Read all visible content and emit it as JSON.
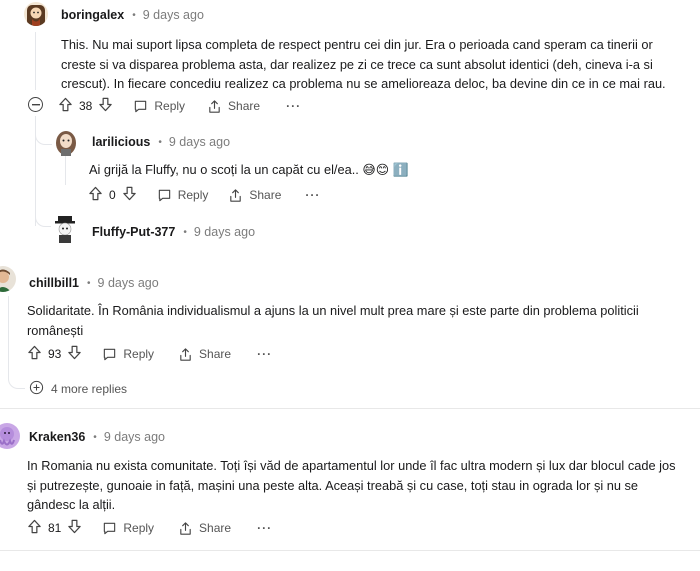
{
  "comments": [
    {
      "user": "boringalex",
      "time": "9 days ago",
      "lines": [
        "This. Nu mai suport lipsa completa de respect pentru cei din jur. Era o perioada cand speram ca tinerii or",
        "creste si va disparea problema asta, dar realizez pe zi ce trece ca sunt absolut identici (deh, cineva i-a si",
        "crescut). In fiecare concediu realizez ca problema nu se amelioreaza deloc, ba devine din ce in ce mai rau."
      ],
      "votes": "38",
      "reply_label": "Reply",
      "share_label": "Share",
      "more_label": "···"
    },
    {
      "user": "larilicious",
      "time": "9 days ago",
      "lines": [
        "Ai grijă la Fluffy, nu o scoți la un capăt cu el/ea.. 😅😊 ℹ️"
      ],
      "votes": "0",
      "reply_label": "Reply",
      "share_label": "Share",
      "more_label": "···"
    },
    {
      "user": "Fluffy-Put-377",
      "time": "9 days ago"
    },
    {
      "user": "chillbill1",
      "time": "9 days ago",
      "lines": [
        "Solidaritate. În România individualismul a ajuns la un nivel mult prea mare și este parte din problema politicii",
        "românești"
      ],
      "votes": "93",
      "reply_label": "Reply",
      "share_label": "Share",
      "more_label": "···",
      "more_replies": "4 more replies"
    },
    {
      "user": "Kraken36",
      "time": "9 days ago",
      "lines": [
        "In Romania nu exista comunitate. Toți își văd de apartamentul lor unde îl fac ultra modern și lux dar blocul cade jos",
        "și putrezește, gunoaie in față, mașini una peste alta. Aceași treabă și cu case, toți stau in ograda lor și nu se",
        "gândesc la alții."
      ],
      "votes": "81",
      "reply_label": "Reply",
      "share_label": "Share",
      "more_label": "···"
    }
  ],
  "separator": "•",
  "colors": {
    "text": "#1a1a1b",
    "meta": "#7c7c7c",
    "thread": "#e5e7eb"
  }
}
